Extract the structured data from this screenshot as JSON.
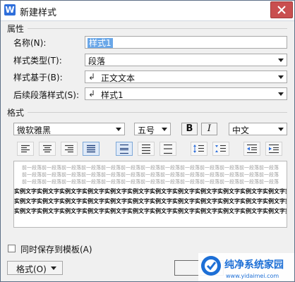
{
  "dialog": {
    "title": "新建样式",
    "app_icon_letter": "W"
  },
  "properties": {
    "section_label": "属性",
    "name_label": "名称(N):",
    "name_value": "样式1",
    "style_type_label": "样式类型(T):",
    "style_type_value": "段落",
    "based_on_label": "样式基于(B):",
    "based_on_value": "正文文本",
    "next_style_label": "后续段落样式(S):",
    "next_style_value": "样式1",
    "paragraph_mark": "↲"
  },
  "format": {
    "section_label": "格式",
    "font_family": "微软雅黑",
    "font_size": "五号",
    "bold_label": "B",
    "italic_label": "I",
    "language": "中文"
  },
  "preview": {
    "previous_paragraph_text": "前一段落前一段落前一段落前一段落前一段落前一段落前一段落前一段落前一段落前一段落前一段落前一段落前一段落",
    "sample_text": "实例文字实例文字实例文字实例文字实例文字实例文字实例文字实例文字实例文字实例文字实例文字实例文字实例文字"
  },
  "footer": {
    "save_to_template_label": "同时保存到模板(A)",
    "format_button_label": "格式(O)",
    "watermark_text": "纯净系统家园",
    "watermark_url": "www.yidaimei.com"
  },
  "colors": {
    "selection_blue": "#6aa7e8",
    "close_red": "#c94f4f",
    "watermark_blue": "#1d6fd6"
  }
}
